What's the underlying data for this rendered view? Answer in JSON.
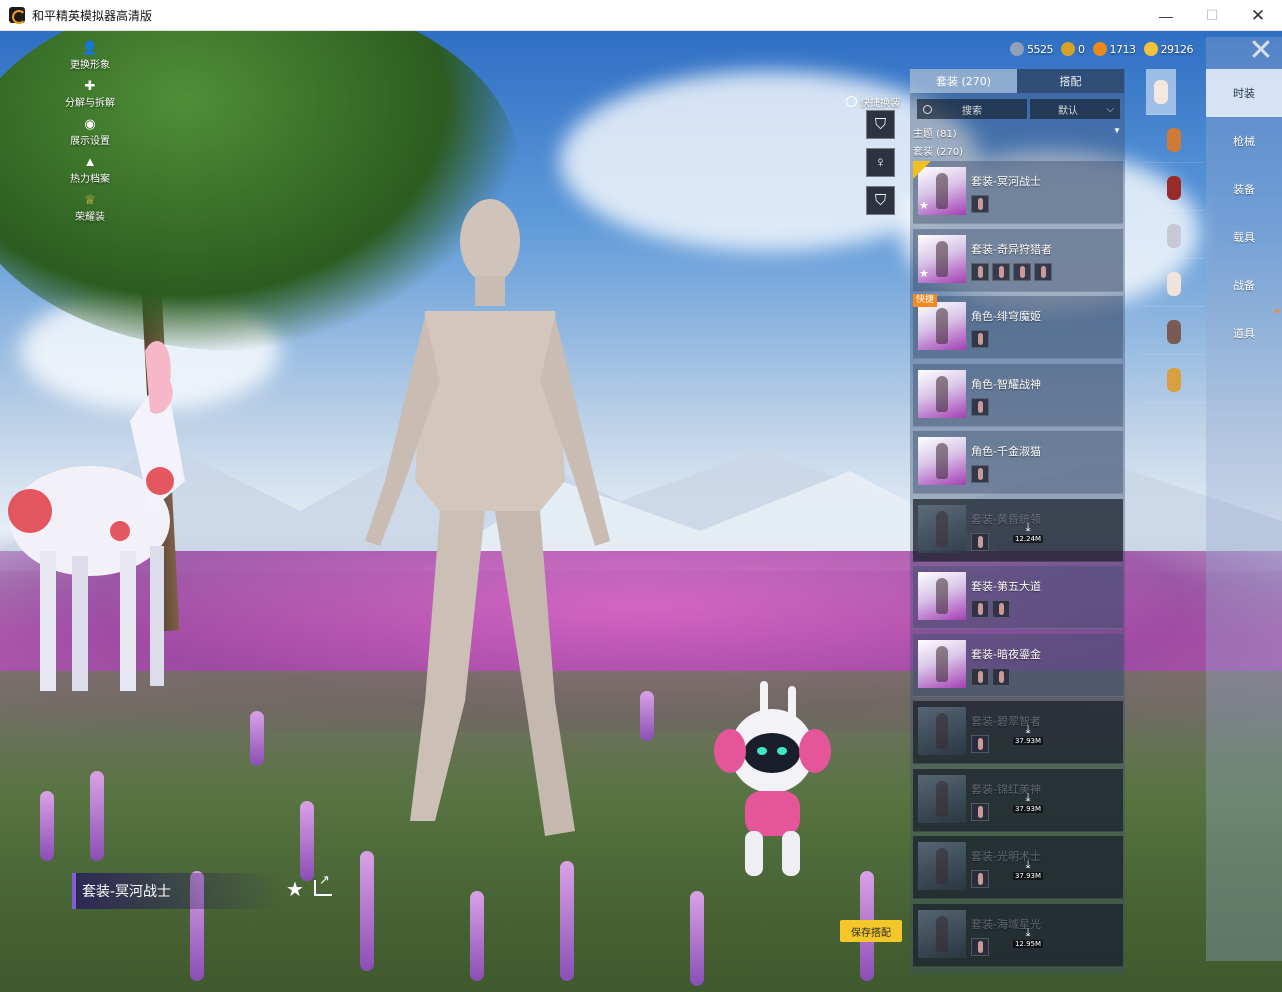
{
  "window": {
    "title": "和平精英模拟器高清版",
    "minimize": "—",
    "maximize": "☐",
    "close": "✕"
  },
  "left_menu": [
    {
      "label": "更换形象",
      "icon": "person-icon",
      "glyph": "👤"
    },
    {
      "label": "分解与拆解",
      "icon": "puzzle-icon",
      "glyph": "✚"
    },
    {
      "label": "展示设置",
      "icon": "eye-icon",
      "glyph": "◉"
    },
    {
      "label": "热力档案",
      "icon": "flame-icon",
      "glyph": "▲"
    },
    {
      "label": "荣耀装",
      "icon": "crown-badge-icon",
      "glyph": "♕"
    }
  ],
  "currencies": [
    {
      "icon": "silver-coin-icon",
      "value": "5525",
      "color": "#8fa0b8"
    },
    {
      "icon": "gold-medal-icon",
      "value": "0",
      "color": "#d8a22a"
    },
    {
      "icon": "orange-token-icon",
      "value": "1713",
      "color": "#e88a1a"
    },
    {
      "icon": "coupon-icon",
      "value": "29126",
      "color": "#f2c33a"
    }
  ],
  "quick_switch": {
    "label": "快捷换装",
    "buttons": [
      {
        "icon": "outfit-hanger-icon",
        "glyph": "⛉"
      },
      {
        "icon": "character-icon",
        "glyph": "♀"
      },
      {
        "icon": "outfit-slot-icon",
        "glyph": "⛉"
      }
    ]
  },
  "panel": {
    "tabs": [
      {
        "label": "套装 (270)",
        "active": true
      },
      {
        "label": "搭配",
        "active": false
      }
    ],
    "search_placeholder": "搜索",
    "sort_label": "默认",
    "theme_label": "主题 (81)",
    "outfit_section_label": "套装 (270)",
    "items": [
      {
        "name": "套装-冥河战士",
        "dim": false,
        "selected": true,
        "star": true,
        "parts": 1,
        "download": null
      },
      {
        "name": "套装-奇异狩猎者",
        "dim": false,
        "selected": false,
        "star": true,
        "parts": 4,
        "download": null
      },
      {
        "name": "角色-绯穹魔姬",
        "dim": false,
        "selected": false,
        "tag": "快捷",
        "parts": 1,
        "download": null
      },
      {
        "name": "角色-智耀战神",
        "dim": false,
        "selected": false,
        "parts": 1,
        "download": null
      },
      {
        "name": "角色-千金淑猫",
        "dim": false,
        "selected": false,
        "parts": 1,
        "download": null
      },
      {
        "name": "套装-黄昏统领",
        "dim": true,
        "selected": false,
        "parts": 1,
        "download": "12.24M"
      },
      {
        "name": "套装-第五大道",
        "dim": false,
        "selected": false,
        "parts": 2,
        "download": null
      },
      {
        "name": "套装-暗夜鎏金",
        "dim": false,
        "selected": false,
        "parts": 2,
        "download": null
      },
      {
        "name": "套装-碧翠智者",
        "dim": true,
        "selected": false,
        "parts": 1,
        "download": "37.93M"
      },
      {
        "name": "套装-锦红美神",
        "dim": true,
        "selected": false,
        "parts": 1,
        "download": "37.93M"
      },
      {
        "name": "套装-光明术士",
        "dim": true,
        "selected": false,
        "parts": 1,
        "download": "37.93M"
      },
      {
        "name": "套装-海域星光",
        "dim": true,
        "selected": false,
        "parts": 1,
        "download": "12.95M"
      }
    ]
  },
  "mini_slots": [
    {
      "icon": "body-slot-icon",
      "color": "#f2e8e0",
      "active": true
    },
    {
      "icon": "hat-slot-icon",
      "color": "#d07a3a"
    },
    {
      "icon": "mask-slot-icon",
      "color": "#9a2a2a"
    },
    {
      "icon": "helmet-slot-icon",
      "color": "#c9c9d6"
    },
    {
      "icon": "suit-slot-icon",
      "color": "#efe3dc"
    },
    {
      "icon": "armor-slot-icon",
      "color": "#7a5a52"
    },
    {
      "icon": "shoes-slot-icon",
      "color": "#d8a040"
    }
  ],
  "categories": [
    {
      "label": "时装",
      "active": true
    },
    {
      "label": "枪械",
      "active": false
    },
    {
      "label": "装备",
      "active": false
    },
    {
      "label": "载具",
      "active": false
    },
    {
      "label": "战备",
      "active": false
    },
    {
      "label": "道具",
      "active": false
    }
  ],
  "current_outfit": "套装-冥河战士",
  "save_button": "保存搭配"
}
